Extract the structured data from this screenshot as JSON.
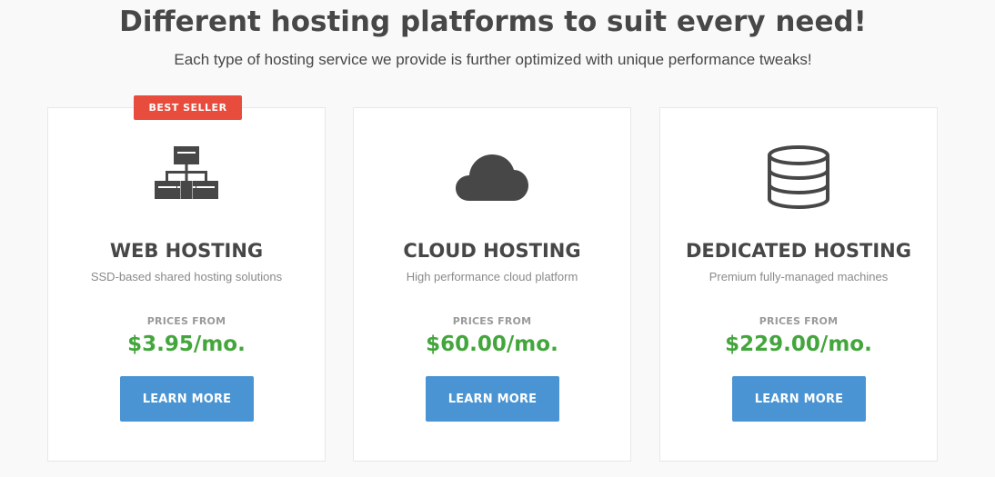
{
  "header": {
    "title": "Different hosting platforms to suit every need!",
    "subtitle": "Each type of hosting service we provide is further optimized with unique performance tweaks!"
  },
  "colors": {
    "badge": "#e74c3c",
    "price": "#43a63c",
    "button": "#4a94d3",
    "icon": "#474747"
  },
  "plans": [
    {
      "badge": "BEST SELLER",
      "icon": "network-sitemap-icon",
      "title": "WEB HOSTING",
      "description": "SSD-based shared hosting solutions",
      "prices_from_label": "PRICES FROM",
      "price": "$3.95/mo.",
      "button_label": "LEARN MORE"
    },
    {
      "icon": "cloud-icon",
      "title": "CLOUD HOSTING",
      "description": "High performance cloud platform",
      "prices_from_label": "PRICES FROM",
      "price": "$60.00/mo.",
      "button_label": "LEARN MORE"
    },
    {
      "icon": "database-icon",
      "title": "DEDICATED HOSTING",
      "description": "Premium fully-managed machines",
      "prices_from_label": "PRICES FROM",
      "price": "$229.00/mo.",
      "button_label": "LEARN MORE"
    }
  ]
}
